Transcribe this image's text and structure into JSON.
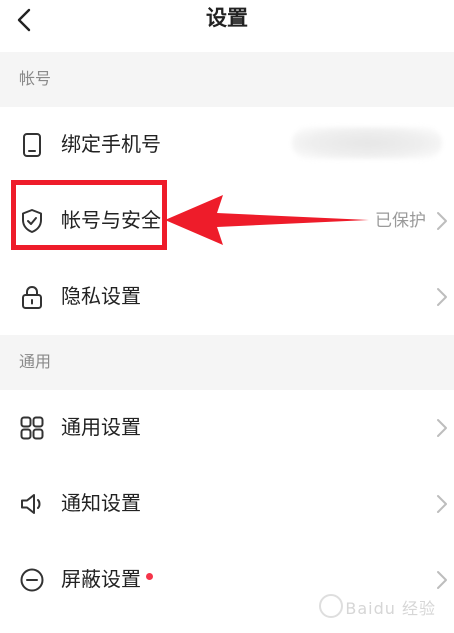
{
  "header": {
    "title": "设置",
    "back_icon": "chevron-left-icon"
  },
  "sections": [
    {
      "title": "帐号",
      "items": [
        {
          "label": "绑定手机号",
          "icon": "phone-icon",
          "status": ""
        },
        {
          "label": "帐号与安全",
          "icon": "shield-check-icon",
          "status": "已保护"
        },
        {
          "label": "隐私设置",
          "icon": "lock-icon",
          "status": ""
        }
      ]
    },
    {
      "title": "通用",
      "items": [
        {
          "label": "通用设置",
          "icon": "grid-icon",
          "status": ""
        },
        {
          "label": "通知设置",
          "icon": "speaker-icon",
          "status": ""
        },
        {
          "label": "屏蔽设置",
          "icon": "minus-circle-icon",
          "status": "",
          "badge_dot": true
        }
      ]
    }
  ],
  "annotation": {
    "highlight_color": "#ee1c2a",
    "arrow_color": "#ee1c2a"
  },
  "colors": {
    "section_bg": "#f5f5f5",
    "section_text": "#8a8a8a",
    "status_text": "#9a9a9a",
    "badge_dot": "#f5344a"
  },
  "watermark": {
    "text": "Baidu 经验"
  }
}
